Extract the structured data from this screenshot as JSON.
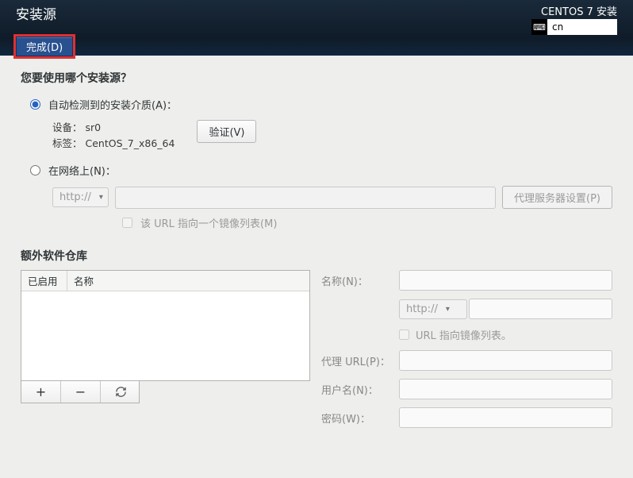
{
  "topbar": {
    "title_left": "安装源",
    "title_right": "CENTOS 7 安装",
    "kb_label": "cn",
    "done_label": "完成(D)"
  },
  "source": {
    "question": "您要使用哪个安装源？",
    "auto_label": "自动检测到的安装介质(A)：",
    "device_label": "设备：",
    "device_value": "sr0",
    "tag_label": "标签：",
    "tag_value": "CentOS_7_x86_64",
    "verify_btn": "验证(V)",
    "net_label": "在网络上(N)：",
    "proto_options": "http://",
    "proxy_btn": "代理服务器设置(P)",
    "mirror_label": "该 URL 指向一个镜像列表(M)"
  },
  "repos": {
    "section_title": "额外软件仓库",
    "col_enabled": "已启用",
    "col_name": "名称",
    "add_tip": "+",
    "remove_tip": "−",
    "name_lbl": "名称(N)：",
    "proto": "http://",
    "mirror2": "URL 指向镜像列表。",
    "proxy_lbl": "代理 URL(P)：",
    "user_lbl": "用户名(N)：",
    "pass_lbl": "密码(W)："
  }
}
